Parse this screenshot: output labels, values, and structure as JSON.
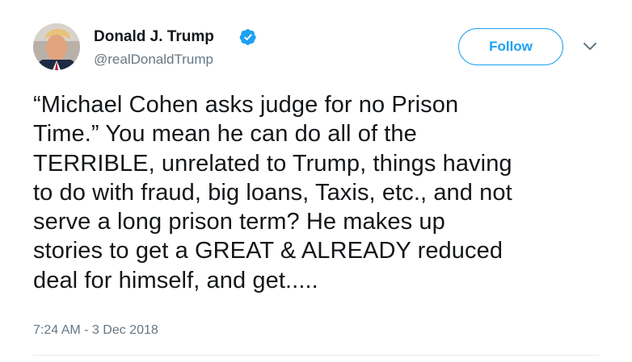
{
  "tweet": {
    "author_name": "Donald J. Trump",
    "author_handle": "@realDonaldTrump",
    "follow_label": "Follow",
    "text": "“Michael Cohen asks judge for no Prison\nTime.” You mean he can do all of the\nTERRIBLE, unrelated to Trump, things having\nto do with fraud, big loans, Taxis, etc., and not\nserve a long prison term? He makes up\nstories to get a GREAT & ALREADY reduced\ndeal for himself, and get.....",
    "timestamp": "7:24 AM - 3 Dec 2018"
  },
  "icons": {
    "verified": "verified-badge-icon",
    "more": "chevron-down-icon"
  },
  "colors": {
    "accent": "#1da1f2",
    "secondary_text": "#657786",
    "primary_text": "#14171a"
  }
}
